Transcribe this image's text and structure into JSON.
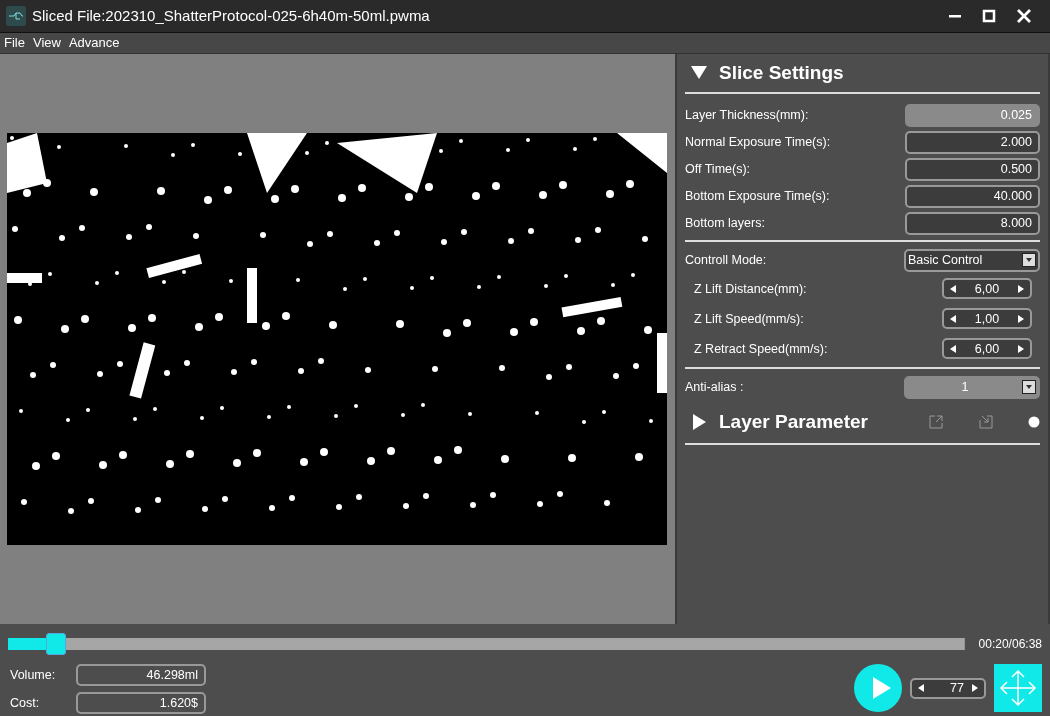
{
  "window": {
    "title": "Sliced File:202310_ShatterProtocol-025-6h40m-50ml.pwma"
  },
  "menu": [
    "File",
    "View",
    "Advance"
  ],
  "slice_settings": {
    "title": "Slice Settings",
    "expanded": true,
    "groups": [
      [
        {
          "kind": "field",
          "label": "Layer Thickness(mm):",
          "value": "0.025",
          "disabled": true
        },
        {
          "kind": "field",
          "label": "Normal Exposure Time(s):",
          "value": "2.000",
          "disabled": false
        },
        {
          "kind": "field",
          "label": "Off Time(s):",
          "value": "0.500",
          "disabled": false
        },
        {
          "kind": "field",
          "label": "Bottom Exposure Time(s):",
          "value": "40.000",
          "disabled": false
        },
        {
          "kind": "field",
          "label": "Bottom layers:",
          "value": "8.000",
          "disabled": false
        }
      ],
      [
        {
          "kind": "select",
          "label": "Controll Mode:",
          "value": "Basic Control",
          "disabled": false
        },
        {
          "kind": "spinner",
          "label": "Z Lift Distance(mm):",
          "value": "6,00",
          "disabled": false
        },
        {
          "kind": "spinner",
          "label": "Z Lift Speed(mm/s):",
          "value": "1,00",
          "disabled": false
        },
        {
          "kind": "spinner",
          "label": "Z Retract Speed(mm/s):",
          "value": "6,00",
          "disabled": false
        }
      ],
      [
        {
          "kind": "select",
          "label": "Anti-alias :",
          "value": "1",
          "disabled": true
        }
      ]
    ]
  },
  "layer_parameter": {
    "title": "Layer Parameter",
    "expanded": false
  },
  "progress": {
    "level": 0.05,
    "time": "00:20/06:38"
  },
  "stats": [
    {
      "label": "Volume:",
      "value": "46.298ml"
    },
    {
      "label": "Cost:",
      "value": "1.620$"
    }
  ],
  "layer_spinner": {
    "value": "77"
  }
}
